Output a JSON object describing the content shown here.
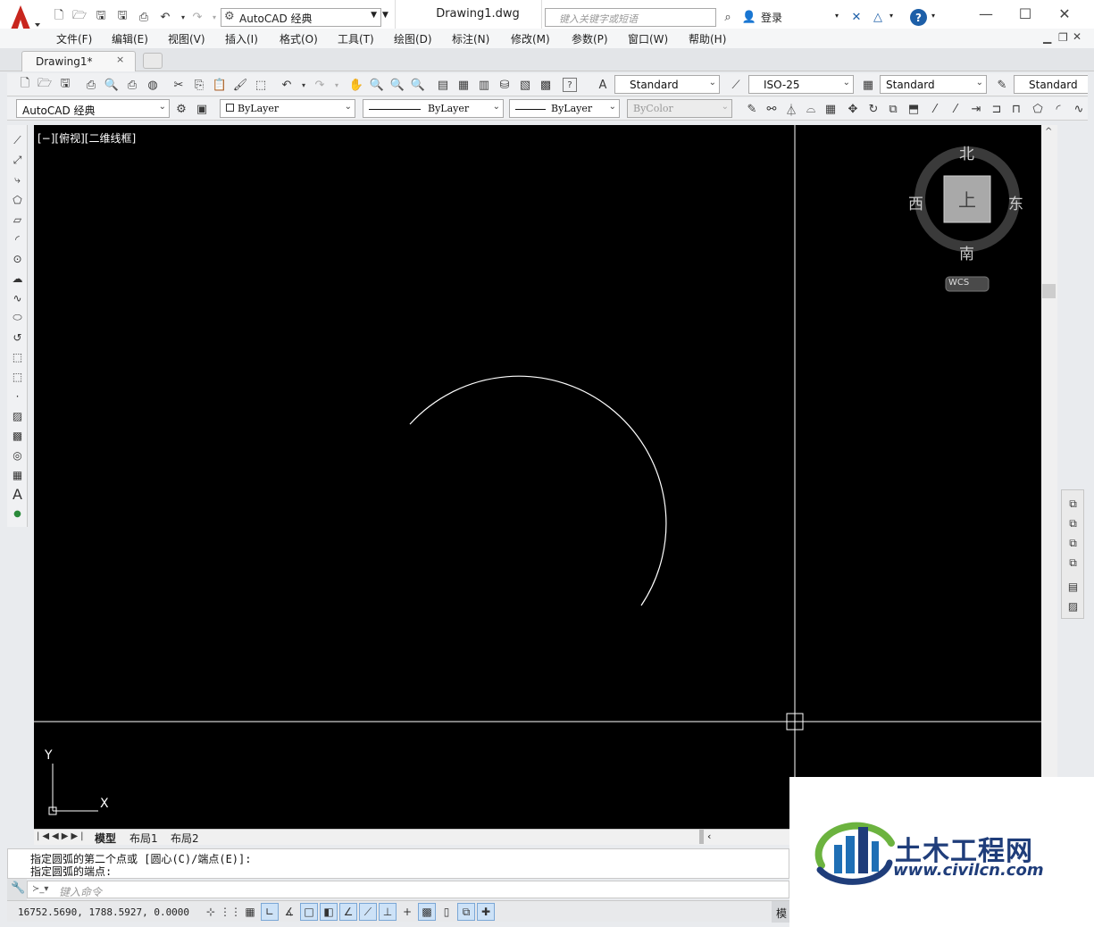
{
  "title_bar": {
    "workspace": "AutoCAD 经典",
    "document": "Drawing1.dwg",
    "search_placeholder": "键入关键字或短语",
    "login": "登录",
    "help": "?"
  },
  "menu": [
    "文件(F)",
    "编辑(E)",
    "视图(V)",
    "插入(I)",
    "格式(O)",
    "工具(T)",
    "绘图(D)",
    "标注(N)",
    "修改(M)",
    "参数(P)",
    "窗口(W)",
    "帮助(H)"
  ],
  "tab": {
    "label": "Drawing1*",
    "close": "×"
  },
  "toolbar1": {
    "text_style": "Standard",
    "dim_style": "ISO-25",
    "table_style": "Standard",
    "multileader_style": "Standard"
  },
  "toolbar2": {
    "workspace": "AutoCAD 经典",
    "layer": "ByLayer",
    "linetype": "ByLayer",
    "lineweight": "ByLayer",
    "color": "ByColor"
  },
  "viewport": {
    "label": "[−][俯视][二维线框]",
    "viewcube": {
      "north": "北",
      "south": "南",
      "east": "东",
      "west": "西",
      "top": "上",
      "wcs": "WCS"
    },
    "ucs": {
      "x": "X",
      "y": "Y"
    }
  },
  "layout_tabs": [
    "模型",
    "布局1",
    "布局2"
  ],
  "command": {
    "history": [
      "指定圆弧的第二个点或 [圆心(C)/端点(E)]:",
      "指定圆弧的端点:"
    ],
    "placeholder": "键入命令"
  },
  "status": {
    "coords": "16752.5690, 1788.5927, 0.0000",
    "model": "模"
  },
  "watermark": {
    "name": "土木工程网",
    "url": "www.civilcn.com"
  },
  "colors": {
    "canvas": "#000000",
    "crosshair": "#ffffff",
    "logo_red": "#c8261e",
    "watermark_blue": "#1f3d7a",
    "watermark_green": "#6cb33f"
  }
}
